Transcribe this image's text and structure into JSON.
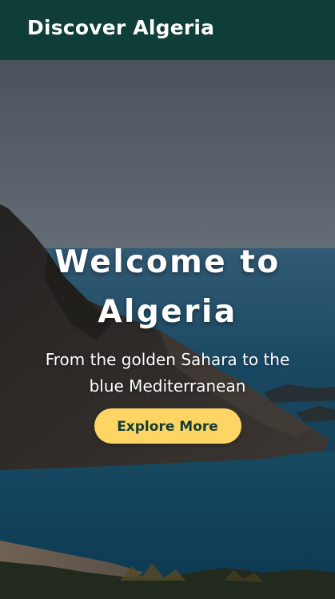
{
  "header": {
    "brand": "Discover Algeria"
  },
  "hero": {
    "title": "Welcome to Algeria",
    "subtitle": "From the golden Sahara to the blue Mediterranean",
    "cta_label": "Explore More"
  },
  "colors": {
    "header_bg": "#0f3d37",
    "cta_bg": "#fdd565",
    "cta_text": "#143d36"
  }
}
